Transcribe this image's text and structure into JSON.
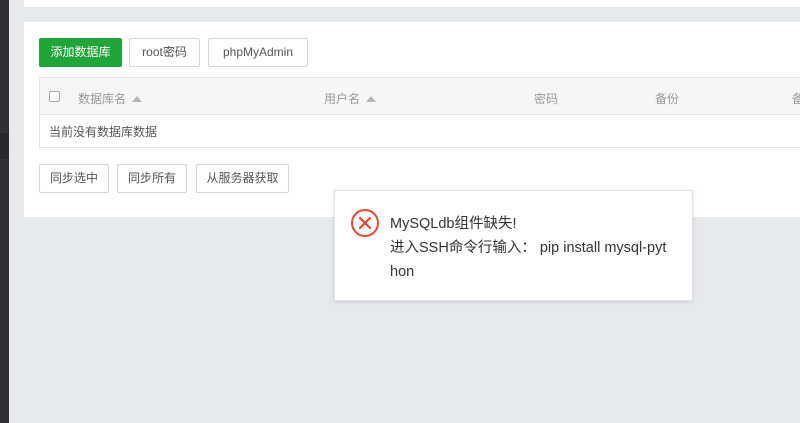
{
  "toolbar": {
    "add_db_label": "添加数据库",
    "root_pwd_label": "root密码",
    "phpmyadmin_label": "phpMyAdmin"
  },
  "table": {
    "columns": [
      "数据库名",
      "用户名",
      "密码",
      "备份",
      "备"
    ],
    "empty_text": "当前没有数据库数据"
  },
  "footer_actions": {
    "sync_selected": "同步选中",
    "sync_all": "同步所有",
    "fetch_from_server": "从服务器获取"
  },
  "toast": {
    "icon": "error-circle-icon",
    "line1": "MySQLdb组件缺失!",
    "line2": "进入SSH命令行输入： pip install mysql-pyt",
    "line3": "hon"
  },
  "colors": {
    "primary": "#20a53a",
    "error": "#e8462f",
    "page_bg": "#e6e9ed"
  }
}
